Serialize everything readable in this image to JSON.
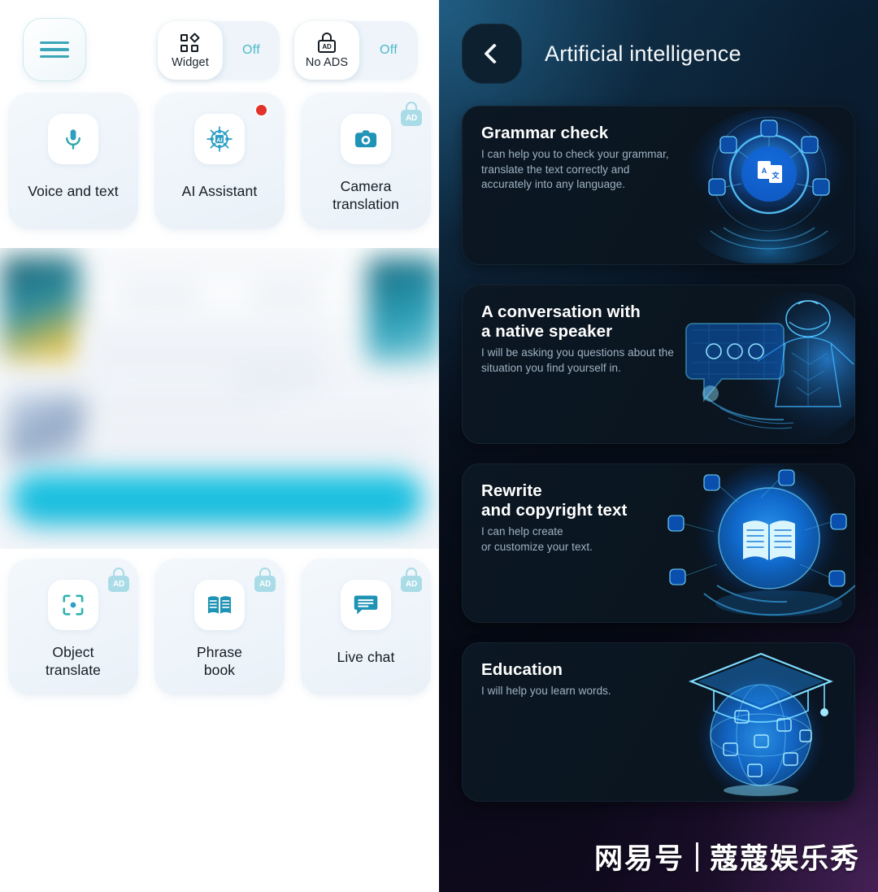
{
  "left": {
    "menu_button": {
      "name": "menu",
      "icon": "hamburger-icon"
    },
    "toggles": [
      {
        "label": "Widget",
        "state": "Off",
        "icon": "widget-icon"
      },
      {
        "label": "No ADS",
        "state": "Off",
        "icon": "ad-lock-icon"
      }
    ],
    "features_row1": [
      {
        "label": "Voice and text",
        "icon": "microphone-icon",
        "badge": "none"
      },
      {
        "label": "AI Assistant",
        "icon": "ai-chip-icon",
        "badge": "notification-dot"
      },
      {
        "label": "Camera\ntranslation",
        "line1": "Camera",
        "line2": "translation",
        "icon": "camera-icon",
        "badge": "ad-lock"
      }
    ],
    "features_row2": [
      {
        "label": "Object\ntranslate",
        "line1": "Object",
        "line2": "translate",
        "icon": "object-scan-icon",
        "badge": "ad-lock"
      },
      {
        "label": "Phrase\nbook",
        "line1": "Phrase",
        "line2": "book",
        "icon": "book-icon",
        "badge": "ad-lock"
      },
      {
        "label": "Live chat",
        "line1": "Live chat",
        "line2": "",
        "icon": "chat-bubble-icon",
        "badge": "ad-lock"
      }
    ],
    "ad_badge_text": "AD",
    "promo": {
      "state": "blurred-advertisement"
    }
  },
  "right": {
    "back_button_icon": "chevron-left-icon",
    "title": "Artificial intelligence",
    "cards": [
      {
        "title": "Grammar check",
        "title_line1": "Grammar check",
        "title_line2": "",
        "description": "I can help you to check your grammar, translate the text correctly and accurately into any language.",
        "desc_line1": "I can help you to check your grammar,",
        "desc_line2": "translate the text correctly and",
        "desc_line3": "accurately into any language.",
        "artwork": "hand-holding-translation-orb"
      },
      {
        "title": "A conversation with a native speaker",
        "title_line1": "A conversation with",
        "title_line2": "a native speaker",
        "description": "I will be asking you questions about the situation you find yourself in.",
        "desc_line1": "I will be asking you questions about the",
        "desc_line2": "situation you find yourself in.",
        "desc_line3": "",
        "artwork": "robot-with-speech-bubble"
      },
      {
        "title": "Rewrite and copyright text",
        "title_line1": "Rewrite",
        "title_line2": " and copyright text",
        "description": "I can help create or customize your text.",
        "desc_line1": "I can help create",
        "desc_line2": "or customize your text.",
        "desc_line3": "",
        "artwork": "hand-holding-book-globe"
      },
      {
        "title": "Education",
        "title_line1": "Education",
        "title_line2": "",
        "description": "I will help you learn words.",
        "desc_line1": "I will help you learn words.",
        "desc_line2": "",
        "desc_line3": "",
        "artwork": "graduation-cap-globe"
      }
    ],
    "watermark": {
      "brand": "网易号",
      "channel": "蔻蔻娱乐秀"
    }
  },
  "colors": {
    "accent_teal": "#3aa6b8",
    "toggle_off_text": "#4cb9c9",
    "notification_red": "#e2322a",
    "ad_badge": "#aadce8",
    "card_light": "#eef4fa",
    "panel_dark": "#08111e",
    "card_dark": "#0b1722",
    "title_white": "#f4f8fb",
    "subtitle_grey": "#9fb2c2"
  }
}
